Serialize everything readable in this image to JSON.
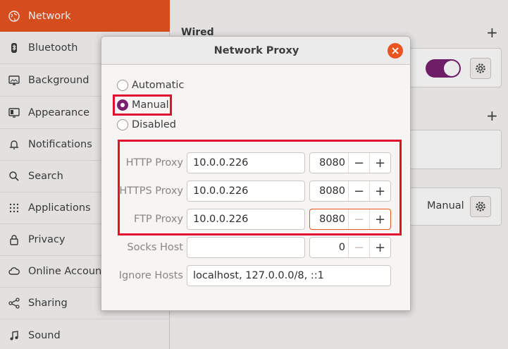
{
  "sidebar": {
    "items": [
      {
        "label": "Network",
        "icon": "network-icon"
      },
      {
        "label": "Bluetooth",
        "icon": "bluetooth-icon"
      },
      {
        "label": "Background",
        "icon": "background-icon"
      },
      {
        "label": "Appearance",
        "icon": "appearance-icon"
      },
      {
        "label": "Notifications",
        "icon": "bell-icon"
      },
      {
        "label": "Search",
        "icon": "search-icon"
      },
      {
        "label": "Applications",
        "icon": "apps-grid-icon"
      },
      {
        "label": "Privacy",
        "icon": "lock-icon"
      },
      {
        "label": "Online Accounts",
        "icon": "cloud-icon"
      },
      {
        "label": "Sharing",
        "icon": "share-icon"
      },
      {
        "label": "Sound",
        "icon": "music-note-icon"
      }
    ]
  },
  "main": {
    "wired_title": "Wired",
    "proxy_mode": "Manual"
  },
  "dialog": {
    "title": "Network Proxy",
    "modes": [
      "Automatic",
      "Manual",
      "Disabled"
    ],
    "selected_mode": "Manual",
    "fields": [
      {
        "label": "HTTP Proxy",
        "host": "10.0.0.226",
        "port": "8080"
      },
      {
        "label": "HTTPS Proxy",
        "host": "10.0.0.226",
        "port": "8080"
      },
      {
        "label": "FTP Proxy",
        "host": "10.0.0.226",
        "port": "8080"
      },
      {
        "label": "Socks Host",
        "host": "",
        "port": "0"
      }
    ],
    "ignore_label": "Ignore Hosts",
    "ignore_value": "localhost, 127.0.0.0/8, ::1"
  },
  "colors": {
    "accent": "#e95420",
    "toggle": "#77216f",
    "highlight": "#e0112f"
  }
}
